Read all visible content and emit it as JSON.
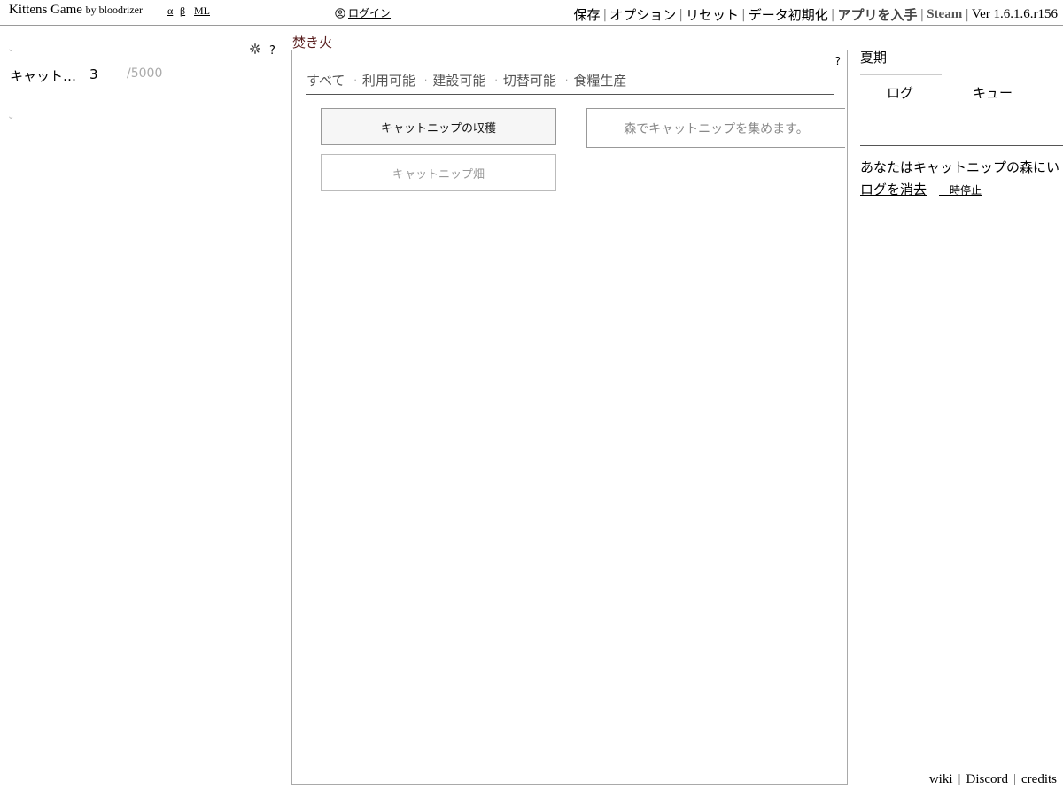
{
  "header": {
    "title": "Kittens Game",
    "by": "by bloodrizer",
    "links": {
      "alpha": "α",
      "beta": "β",
      "ml": "ML"
    },
    "login": "ログイン",
    "menu": {
      "save": "保存",
      "options": "オプション",
      "reset": "リセット",
      "wipe": "データ初期化",
      "get_app": "アプリを入手",
      "steam": "Steam",
      "version": "Ver 1.6.1.6.r156"
    }
  },
  "left": {
    "help": "?",
    "resources": [
      {
        "name": "キャット…",
        "amount": "3",
        "max": "/5000"
      }
    ]
  },
  "center": {
    "title": "焚き火",
    "help": "?",
    "filters": [
      "すべて",
      "利用可能",
      "建設可能",
      "切替可能",
      "食糧生産"
    ],
    "buttons": {
      "harvest": "キャットニップの収穫",
      "field": "キャットニップ畑"
    },
    "tooltip": "森でキャットニップを集めます。"
  },
  "right": {
    "season": "夏期",
    "tabs": {
      "log": "ログ",
      "queue": "キュー"
    },
    "log_message": "あなたはキャットニップの森にい",
    "clear_log": "ログを消去",
    "pause": "一時停止"
  },
  "footer": {
    "wiki": "wiki",
    "discord": "Discord",
    "credits": "credits"
  }
}
